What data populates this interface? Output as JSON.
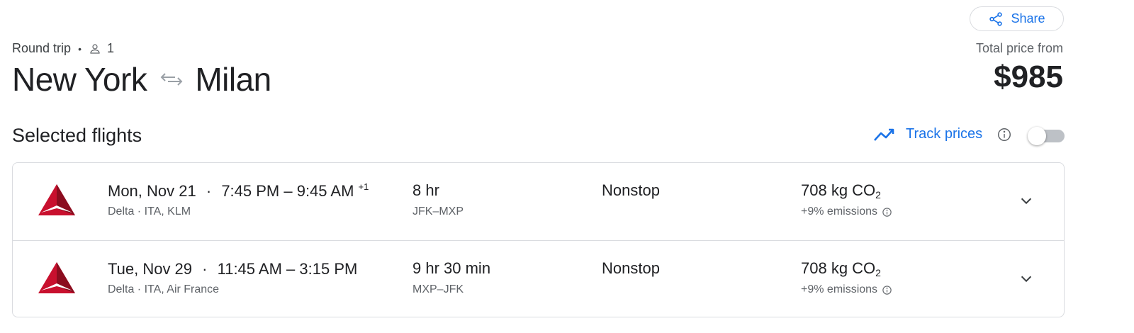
{
  "header": {
    "share_label": "Share",
    "trip_type": "Round trip",
    "passenger_count": "1",
    "origin": "New York",
    "destination": "Milan",
    "price_label": "Total price from",
    "price": "$985"
  },
  "section": {
    "title": "Selected flights",
    "track_label": "Track prices",
    "track_enabled": false
  },
  "flights": [
    {
      "date": "Mon, Nov 21",
      "times": "7:45 PM – 9:45 AM",
      "day_offset": "+1",
      "carriers": "Delta · ITA, KLM",
      "duration": "8 hr",
      "airports": "JFK–MXP",
      "stops": "Nonstop",
      "co2_value": "708 kg CO",
      "co2_sub": "2",
      "emissions": "+9% emissions"
    },
    {
      "date": "Tue, Nov 29",
      "times": "11:45 AM – 3:15 PM",
      "day_offset": "",
      "carriers": "Delta · ITA, Air France",
      "duration": "9 hr 30 min",
      "airports": "MXP–JFK",
      "stops": "Nonstop",
      "co2_value": "708 kg CO",
      "co2_sub": "2",
      "emissions": "+9% emissions"
    }
  ],
  "colors": {
    "accent": "#1a73e8",
    "delta_red": "#c8102e",
    "border": "#dadce0"
  },
  "icons": [
    "share-icon",
    "person-icon",
    "swap-arrows-icon",
    "trend-icon",
    "info-icon",
    "delta-logo-icon",
    "chevron-down-icon"
  ]
}
